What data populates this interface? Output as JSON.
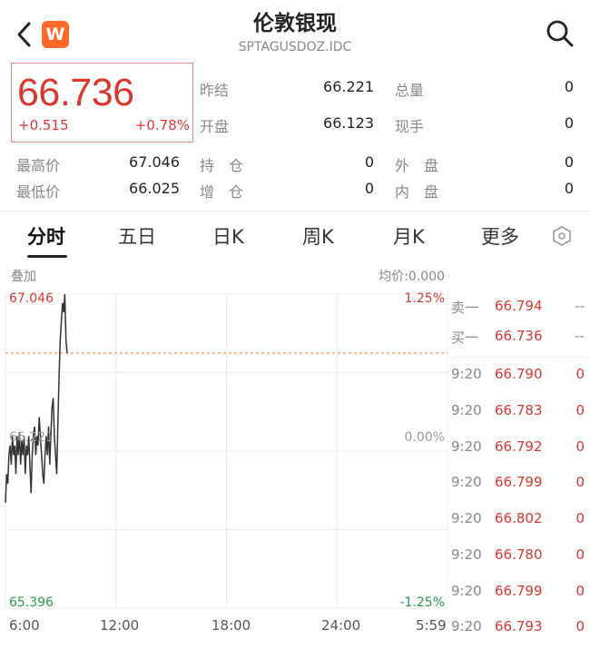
{
  "header": {
    "title": "伦敦银现",
    "code": "SPTAGUSDOZ.IDC",
    "logo_letter": "W"
  },
  "quote": {
    "price": "66.736",
    "change": "+0.515",
    "change_pct": "+0.78%",
    "fields": {
      "prev_close_label": "昨结",
      "prev_close": "66.221",
      "total_vol_label": "总量",
      "total_vol": "0",
      "open_label": "开盘",
      "open": "66.123",
      "cur_vol_label": "现手",
      "cur_vol": "0",
      "high_label": "最高价",
      "high": "67.046",
      "low_label": "最低价",
      "low": "66.025",
      "hold_label": "持　仓",
      "hold": "0",
      "add_label": "增　仓",
      "add": "0",
      "outer_label": "外　盘",
      "outer": "0",
      "inner_label": "内　盘",
      "inner": "0"
    }
  },
  "tabs": [
    "分时",
    "五日",
    "日K",
    "周K",
    "月K",
    "更多"
  ],
  "chart": {
    "overlay_label": "叠加",
    "avg_label": "均价:0.000",
    "y_top": "67.046",
    "y_mid": "66.221",
    "y_bottom": "65.396",
    "pct_top": "1.25%",
    "pct_mid": "0.00%",
    "pct_bottom": "-1.25%",
    "x_labels": [
      "6:00",
      "12:00",
      "18:00",
      "24:00",
      "5:59"
    ]
  },
  "chart_data": {
    "type": "line",
    "x_range": [
      "6:00",
      "5:59"
    ],
    "ylim": [
      65.396,
      67.046
    ],
    "prev_close": 66.221,
    "current": 66.736,
    "series": [
      {
        "values": [
          65.95,
          66.1,
          66.05,
          66.2,
          66.25,
          66.15,
          66.3,
          66.2,
          66.25,
          66.1,
          66.3,
          66.2,
          66.32,
          66.15,
          66.28,
          66.2,
          66.3,
          66.1,
          66.25,
          66.2,
          66.3,
          66.15,
          66.0,
          66.2,
          66.3,
          66.35,
          66.2,
          66.3,
          66.25,
          66.4,
          66.3,
          66.2,
          66.1,
          66.05,
          66.2,
          66.3,
          66.2,
          66.35,
          66.15,
          66.3,
          66.45,
          66.5,
          66.3,
          66.2,
          66.1,
          66.35,
          66.6,
          66.8,
          66.9,
          67.0,
          66.95,
          67.046,
          66.8,
          66.736
        ]
      }
    ],
    "grid": true
  },
  "book": [
    {
      "label": "卖一",
      "price": "66.794",
      "vol": "--"
    },
    {
      "label": "买一",
      "price": "66.736",
      "vol": "--"
    }
  ],
  "ticks": [
    {
      "time": "9:20",
      "price": "66.790",
      "vol": "0"
    },
    {
      "time": "9:20",
      "price": "66.783",
      "vol": "0"
    },
    {
      "time": "9:20",
      "price": "66.792",
      "vol": "0"
    },
    {
      "time": "9:20",
      "price": "66.799",
      "vol": "0"
    },
    {
      "time": "9:20",
      "price": "66.802",
      "vol": "0"
    },
    {
      "time": "9:20",
      "price": "66.780",
      "vol": "0"
    },
    {
      "time": "9:20",
      "price": "66.799",
      "vol": "0"
    },
    {
      "time": "9:20",
      "price": "66.793",
      "vol": "0"
    }
  ],
  "colors": {
    "up": "#d9382f",
    "down": "#2a9d4b",
    "grid": "#ececec",
    "line": "#333333",
    "ref": "#e07b2e"
  }
}
